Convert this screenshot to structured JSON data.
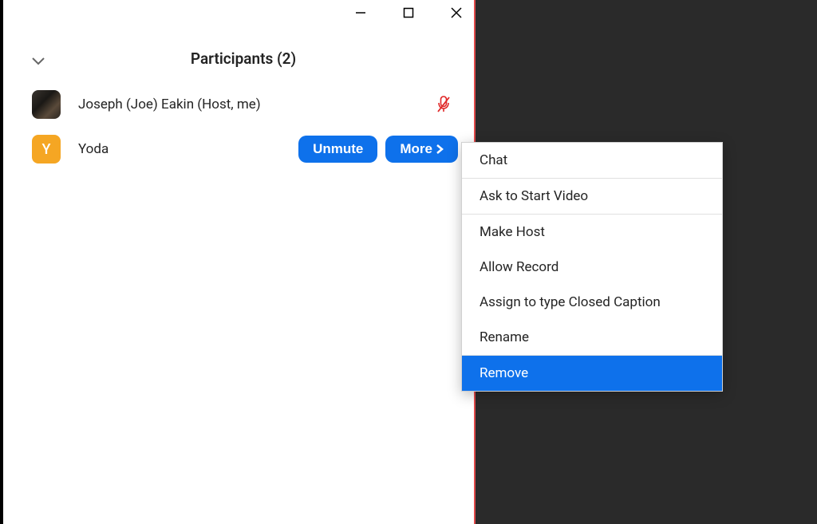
{
  "panel": {
    "title": "Participants (2)"
  },
  "participants": [
    {
      "name": "Joseph (Joe) Eakin (Host, me)",
      "avatar_initial": "",
      "muted": true
    },
    {
      "name": "Yoda",
      "avatar_initial": "Y"
    }
  ],
  "buttons": {
    "unmute": "Unmute",
    "more": "More"
  },
  "menu": {
    "chat": "Chat",
    "ask_video": "Ask to Start Video",
    "make_host": "Make Host",
    "allow_record": "Allow Record",
    "closed_caption": "Assign to type Closed Caption",
    "rename": "Rename",
    "remove": "Remove"
  }
}
